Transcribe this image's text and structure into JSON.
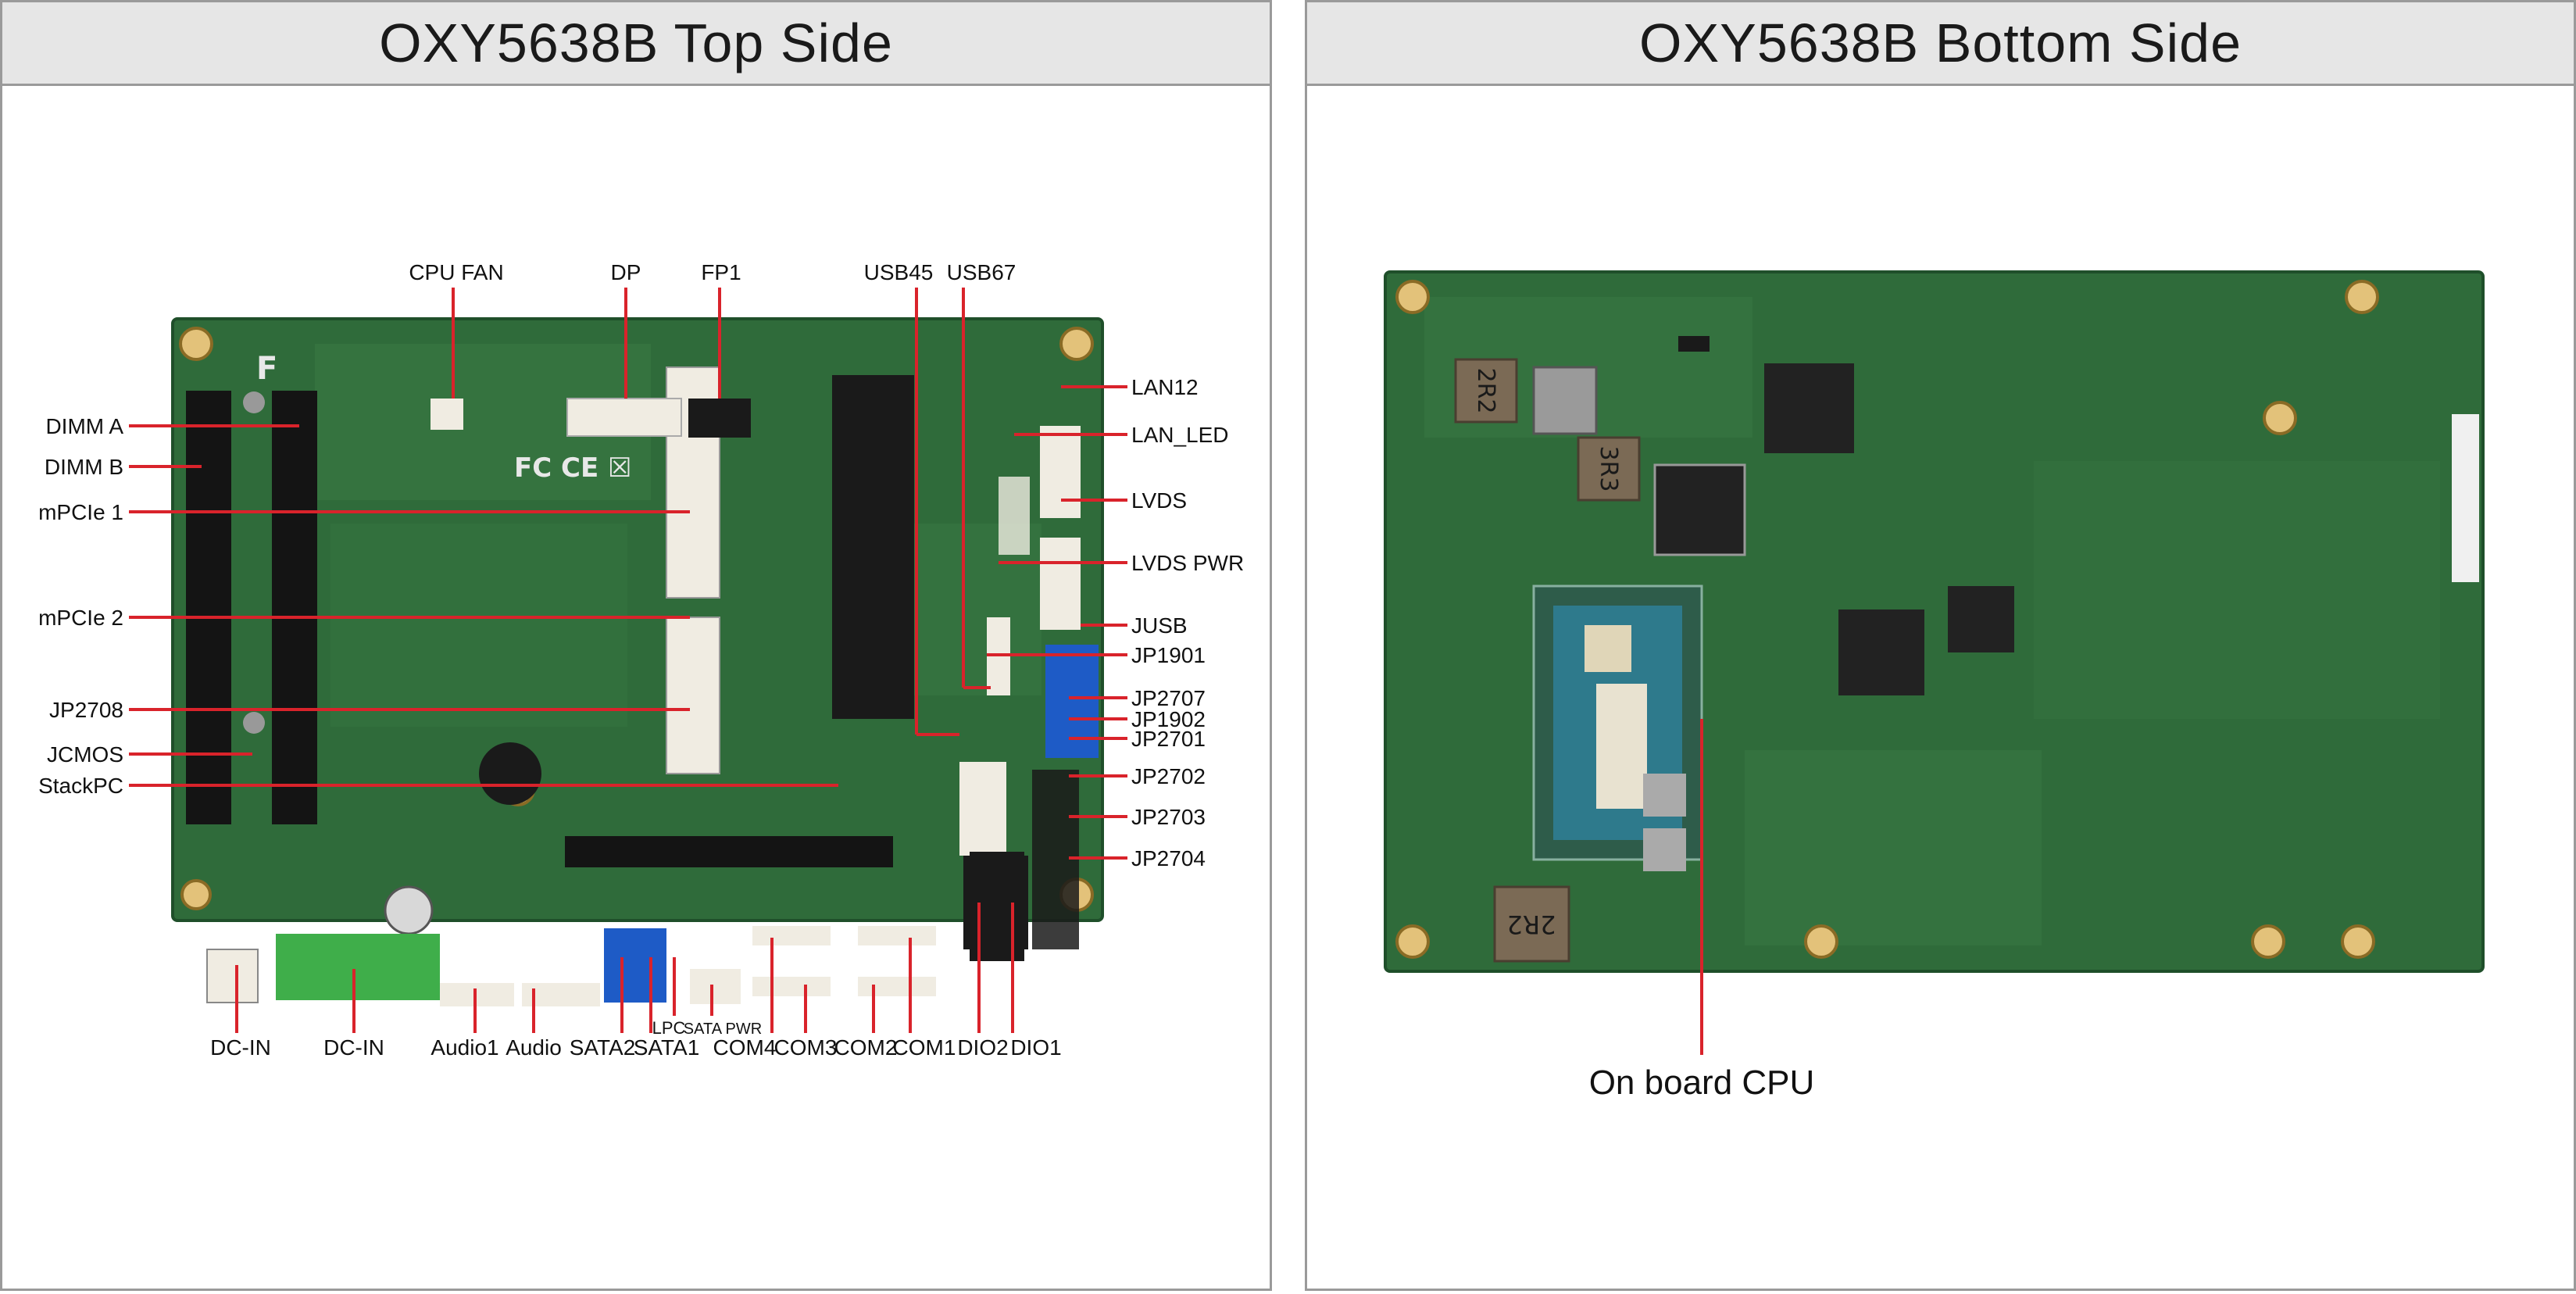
{
  "top_panel": {
    "title": "OXY5638B Top Side",
    "labels": {
      "cpu_fan": "CPU FAN",
      "dp": "DP",
      "fp1": "FP1",
      "usb45": "USB45",
      "usb67": "USB67",
      "dimm_a": "DIMM A",
      "dimm_b": "DIMM B",
      "mpcie1": "mPCIe 1",
      "mpcie2": "mPCIe 2",
      "jp2708": "JP2708",
      "jcmos": "JCMOS",
      "stackpc": "StackPC",
      "lan12": "LAN12",
      "lan_led": "LAN_LED",
      "lvds": "LVDS",
      "lvds_pwr": "LVDS PWR",
      "jusb": "JUSB",
      "jp1901": "JP1901",
      "jp2707": "JP2707",
      "jp1902": "JP1902",
      "jp2701": "JP2701",
      "jp2702": "JP2702",
      "jp2703": "JP2703",
      "jp2704": "JP2704",
      "dcin_1": "DC-IN",
      "dcin_2": "DC-IN",
      "audio1": "Audio1",
      "audio": "Audio",
      "sata2": "SATA2",
      "sata1": "SATA1",
      "lpc": "LPC",
      "sata_pwr": "SATA PWR",
      "com4": "COM4",
      "com3": "COM3",
      "com2": "COM2",
      "com1": "COM1",
      "dio2": "DIO2",
      "dio1": "DIO1"
    }
  },
  "bottom_panel": {
    "title": "OXY5638B Bottom Side",
    "labels": {
      "cpu": "On board CPU",
      "inductor_2r2_a": "2R2",
      "inductor_3r3": "3R3",
      "inductor_2r2_b": "2R2"
    }
  },
  "colors": {
    "pcb": "#2f6b3a",
    "pcb_dark": "#1f4f2a",
    "callout": "#d9232b",
    "connector_white": "#f0ece2",
    "connector_black": "#1a1a1a",
    "sata_blue": "#1e5bc6",
    "terminal_green": "#3fae4a",
    "cpu_die": "#2e7a8c"
  }
}
